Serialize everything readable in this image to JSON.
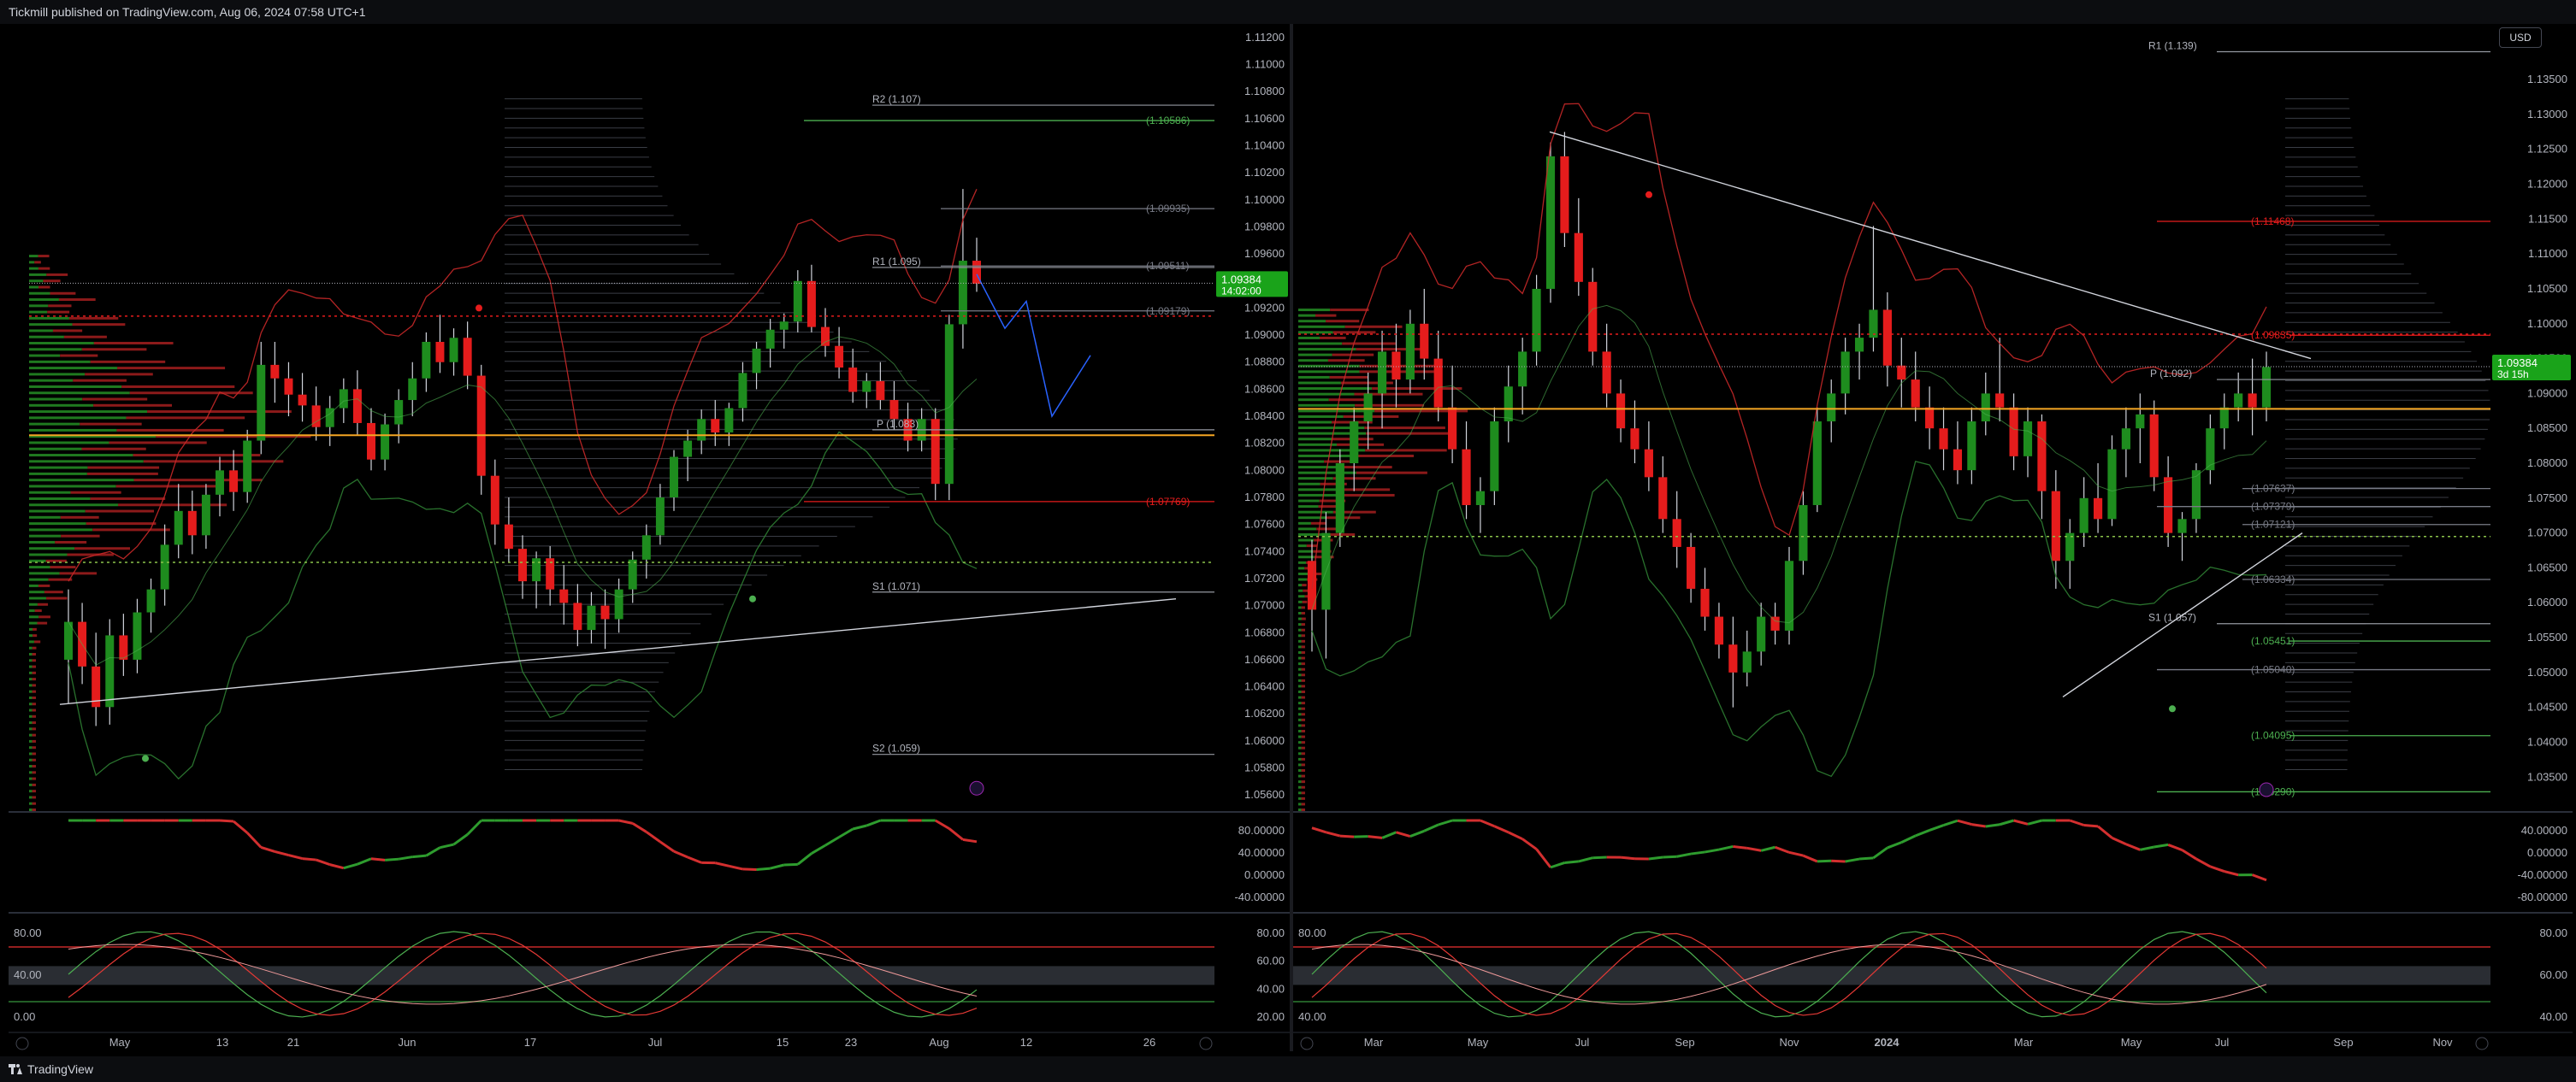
{
  "header": {
    "published": "Tickmill published on TradingView.com, Aug 06, 2024 07:58 UTC+1"
  },
  "footer": {
    "brand": "TradingView"
  },
  "colors": {
    "up": "#1e8c1e",
    "down": "#e51c1c",
    "poc": "#f5a623",
    "green_line": "#4caf50",
    "red_line": "#c62828",
    "pivot": "#9598a1",
    "label_bg_green": "#1a8a1a",
    "price_tag": "#1aa31a"
  },
  "left": {
    "price_tag": "1.09384",
    "countdown": "14:02:00",
    "price_axis": [
      "1.11200",
      "1.11000",
      "1.10800",
      "1.10600",
      "1.10400",
      "1.10200",
      "1.10000",
      "1.09800",
      "1.09600",
      "1.09400",
      "1.09200",
      "1.09000",
      "1.08800",
      "1.08600",
      "1.08400",
      "1.08200",
      "1.08000",
      "1.07800",
      "1.07600",
      "1.07400",
      "1.07200",
      "1.07000",
      "1.06800",
      "1.06600",
      "1.06400",
      "1.06200",
      "1.06000",
      "1.05800",
      "1.05600"
    ],
    "time_axis": [
      "May",
      "13",
      "21",
      "Jun",
      "17",
      "Jul",
      "15",
      "23",
      "Aug",
      "12",
      "26"
    ],
    "pivots": [
      {
        "label": "R2 (1.107)"
      },
      {
        "label": "R1 (1.095)"
      },
      {
        "label": "P (1.083)"
      },
      {
        "label": "S1 (1.071)"
      },
      {
        "label": "S2 (1.059)"
      }
    ],
    "levels": [
      {
        "label": "(1.10586)",
        "color": "#4caf50"
      },
      {
        "label": "(1.09935)",
        "color": "#787b86"
      },
      {
        "label": "(1.09511)",
        "color": "#787b86"
      },
      {
        "label": "(1.09179)",
        "color": "#787b86"
      },
      {
        "label": "(1.07769)",
        "color": "#e51c1c"
      }
    ],
    "osc1_axis": [
      "80.00000",
      "40.00000",
      "0.00000",
      "-40.00000"
    ],
    "osc2_axis_left": [
      "80.00",
      "40.00",
      "0.00"
    ],
    "osc2_axis_right": [
      "80.00",
      "60.00",
      "40.00",
      "20.00"
    ]
  },
  "right": {
    "price_tag": "1.09384",
    "countdown": "3d 15h",
    "currency": "USD",
    "price_axis": [
      "1.13500",
      "1.13000",
      "1.12500",
      "1.12000",
      "1.11500",
      "1.11000",
      "1.10500",
      "1.10000",
      "1.09500",
      "1.09000",
      "1.08500",
      "1.08000",
      "1.07500",
      "1.07000",
      "1.06500",
      "1.06000",
      "1.05500",
      "1.05000",
      "1.04500",
      "1.04000",
      "1.03500"
    ],
    "time_axis": [
      "Mar",
      "May",
      "Jul",
      "Sep",
      "Nov",
      "2024",
      "Mar",
      "May",
      "Jul",
      "Sep",
      "Nov"
    ],
    "pivots": [
      {
        "label": "R1 (1.139)"
      },
      {
        "label": "P (1.092)"
      },
      {
        "label": "S1 (1.057)"
      }
    ],
    "levels": [
      {
        "label": "(1.11468)",
        "color": "#e51c1c"
      },
      {
        "label": "(1.09835)",
        "color": "#e51c1c"
      },
      {
        "label": "(1.07637)",
        "color": "#787b86"
      },
      {
        "label": "(1.07379)",
        "color": "#787b86"
      },
      {
        "label": "(1.07121)",
        "color": "#787b86"
      },
      {
        "label": "(1.06334)",
        "color": "#787b86"
      },
      {
        "label": "(1.05451)",
        "color": "#4caf50"
      },
      {
        "label": "(1.05040)",
        "color": "#787b86"
      },
      {
        "label": "(1.04095)",
        "color": "#4caf50"
      },
      {
        "label": "(1.03290)",
        "color": "#4caf50"
      }
    ],
    "osc1_axis": [
      "40.00000",
      "0.00000",
      "-40.00000",
      "-80.00000"
    ],
    "osc2_axis_left": [
      "80.00",
      "40.00"
    ],
    "osc2_axis_right": [
      "80.00",
      "60.00",
      "40.00"
    ]
  },
  "chart_data": [
    {
      "type": "candlestick",
      "symbol_panel": "left",
      "x_range": [
        "Apr 22, 2024",
        "Sep 02, 2024"
      ],
      "ylim": [
        1.055,
        1.1125
      ],
      "last_price": 1.09384,
      "candles_ohlc": [
        [
          1.066,
          1.0712,
          1.0628,
          1.0688
        ],
        [
          1.0688,
          1.0702,
          1.0642,
          1.0655
        ],
        [
          1.0655,
          1.068,
          1.0611,
          1.0625
        ],
        [
          1.0625,
          1.069,
          1.0612,
          1.0678
        ],
        [
          1.0678,
          1.0694,
          1.0648,
          1.066
        ],
        [
          1.066,
          1.0705,
          1.065,
          1.0695
        ],
        [
          1.0695,
          1.072,
          1.068,
          1.0712
        ],
        [
          1.0712,
          1.076,
          1.07,
          1.0745
        ],
        [
          1.0745,
          1.079,
          1.0735,
          1.077
        ],
        [
          1.077,
          1.0785,
          1.0738,
          1.0752
        ],
        [
          1.0752,
          1.079,
          1.0742,
          1.0782
        ],
        [
          1.0782,
          1.081,
          1.0766,
          1.08
        ],
        [
          1.08,
          1.0815,
          1.077,
          1.0784
        ],
        [
          1.0784,
          1.083,
          1.0776,
          1.0822
        ],
        [
          1.0822,
          1.0895,
          1.0812,
          1.0878
        ],
        [
          1.0878,
          1.0895,
          1.085,
          1.0868
        ],
        [
          1.0868,
          1.088,
          1.084,
          1.0856
        ],
        [
          1.0856,
          1.0872,
          1.0836,
          1.0848
        ],
        [
          1.0848,
          1.0862,
          1.0822,
          1.0832
        ],
        [
          1.0832,
          1.0855,
          1.0818,
          1.0846
        ],
        [
          1.0846,
          1.0868,
          1.0835,
          1.086
        ],
        [
          1.086,
          1.0874,
          1.0826,
          1.0835
        ],
        [
          1.0835,
          1.0846,
          1.08,
          1.0808
        ],
        [
          1.0808,
          1.0842,
          1.08,
          1.0834
        ],
        [
          1.0834,
          1.086,
          1.082,
          1.0852
        ],
        [
          1.0852,
          1.088,
          1.084,
          1.0868
        ],
        [
          1.0868,
          1.0902,
          1.0858,
          1.0895
        ],
        [
          1.0895,
          1.0915,
          1.0872,
          1.088
        ],
        [
          1.088,
          1.0905,
          1.087,
          1.0898
        ],
        [
          1.0898,
          1.091,
          1.086,
          1.087
        ],
        [
          1.087,
          1.0878,
          1.0782,
          1.0796
        ],
        [
          1.0796,
          1.0808,
          1.0745,
          1.076
        ],
        [
          1.076,
          1.078,
          1.0732,
          1.0742
        ],
        [
          1.0742,
          1.0752,
          1.0705,
          1.0718
        ],
        [
          1.0718,
          1.074,
          1.0698,
          1.0735
        ],
        [
          1.0735,
          1.0744,
          1.07,
          1.0712
        ],
        [
          1.0712,
          1.073,
          1.0686,
          1.0702
        ],
        [
          1.0702,
          1.0716,
          1.067,
          1.0682
        ],
        [
          1.0682,
          1.071,
          1.0672,
          1.07
        ],
        [
          1.07,
          1.0712,
          1.0668,
          1.069
        ],
        [
          1.069,
          1.072,
          1.068,
          1.0712
        ],
        [
          1.0712,
          1.074,
          1.0702,
          1.0734
        ],
        [
          1.0734,
          1.076,
          1.072,
          1.0752
        ],
        [
          1.0752,
          1.079,
          1.0745,
          1.078
        ],
        [
          1.078,
          1.0815,
          1.077,
          1.081
        ],
        [
          1.081,
          1.083,
          1.0792,
          1.0822
        ],
        [
          1.0822,
          1.0845,
          1.0812,
          1.0838
        ],
        [
          1.0838,
          1.0852,
          1.0818,
          1.0828
        ],
        [
          1.0828,
          1.085,
          1.0818,
          1.0846
        ],
        [
          1.0846,
          1.088,
          1.0836,
          1.0872
        ],
        [
          1.0872,
          1.0895,
          1.086,
          1.089
        ],
        [
          1.089,
          1.0912,
          1.0876,
          1.0904
        ],
        [
          1.0904,
          1.0916,
          1.089,
          1.091
        ],
        [
          1.091,
          1.0948,
          1.0902,
          1.094
        ],
        [
          1.094,
          1.0952,
          1.0902,
          1.0906
        ],
        [
          1.0906,
          1.092,
          1.0884,
          1.0892
        ],
        [
          1.0892,
          1.0906,
          1.0868,
          1.0876
        ],
        [
          1.0876,
          1.089,
          1.085,
          1.0858
        ],
        [
          1.0858,
          1.0872,
          1.0846,
          1.0866
        ],
        [
          1.0866,
          1.088,
          1.0845,
          1.0852
        ],
        [
          1.0852,
          1.0866,
          1.083,
          1.0838
        ],
        [
          1.0838,
          1.085,
          1.0814,
          1.0822
        ],
        [
          1.0822,
          1.0846,
          1.0814,
          1.0838
        ],
        [
          1.0838,
          1.0846,
          1.0778,
          1.079
        ],
        [
          1.079,
          1.0915,
          1.0778,
          1.0908
        ],
        [
          1.0908,
          1.1008,
          1.089,
          1.0955
        ],
        [
          1.0955,
          1.0972,
          1.0932,
          1.0938
        ]
      ],
      "overlays": [
        "bollinger bands",
        "volume profile",
        "pivot points",
        "trendline",
        "projection path"
      ]
    },
    {
      "type": "candlestick",
      "symbol_panel": "right",
      "x_range": [
        "Feb 2023",
        "Nov 2024"
      ],
      "ylim": [
        1.0305,
        1.142
      ],
      "last_price": 1.09384,
      "candles_ohlc": [
        [
          1.066,
          1.069,
          1.053,
          1.059
        ],
        [
          1.059,
          1.073,
          1.052,
          1.07
        ],
        [
          1.07,
          1.082,
          1.068,
          1.08
        ],
        [
          1.08,
          1.088,
          1.076,
          1.086
        ],
        [
          1.086,
          1.093,
          1.082,
          1.09
        ],
        [
          1.09,
          1.099,
          1.085,
          1.096
        ],
        [
          1.096,
          1.1,
          1.088,
          1.092
        ],
        [
          1.092,
          1.102,
          1.09,
          1.1
        ],
        [
          1.1,
          1.105,
          1.092,
          1.095
        ],
        [
          1.095,
          1.099,
          1.086,
          1.088
        ],
        [
          1.088,
          1.094,
          1.08,
          1.082
        ],
        [
          1.082,
          1.086,
          1.072,
          1.074
        ],
        [
          1.074,
          1.078,
          1.07,
          1.076
        ],
        [
          1.076,
          1.088,
          1.074,
          1.086
        ],
        [
          1.086,
          1.094,
          1.083,
          1.091
        ],
        [
          1.091,
          1.098,
          1.087,
          1.096
        ],
        [
          1.096,
          1.107,
          1.094,
          1.105
        ],
        [
          1.105,
          1.126,
          1.103,
          1.124
        ],
        [
          1.124,
          1.1275,
          1.111,
          1.113
        ],
        [
          1.113,
          1.118,
          1.104,
          1.106
        ],
        [
          1.106,
          1.108,
          1.094,
          1.096
        ],
        [
          1.096,
          1.1,
          1.088,
          1.09
        ],
        [
          1.09,
          1.092,
          1.083,
          1.085
        ],
        [
          1.085,
          1.089,
          1.08,
          1.082
        ],
        [
          1.082,
          1.086,
          1.076,
          1.078
        ],
        [
          1.078,
          1.081,
          1.07,
          1.072
        ],
        [
          1.072,
          1.076,
          1.065,
          1.068
        ],
        [
          1.068,
          1.07,
          1.06,
          1.062
        ],
        [
          1.062,
          1.065,
          1.056,
          1.058
        ],
        [
          1.058,
          1.06,
          1.052,
          1.054
        ],
        [
          1.054,
          1.058,
          1.045,
          1.05
        ],
        [
          1.05,
          1.056,
          1.048,
          1.053
        ],
        [
          1.053,
          1.06,
          1.051,
          1.058
        ],
        [
          1.058,
          1.06,
          1.054,
          1.056
        ],
        [
          1.056,
          1.068,
          1.054,
          1.066
        ],
        [
          1.066,
          1.076,
          1.064,
          1.074
        ],
        [
          1.074,
          1.088,
          1.073,
          1.086
        ],
        [
          1.086,
          1.092,
          1.083,
          1.09
        ],
        [
          1.09,
          1.098,
          1.087,
          1.096
        ],
        [
          1.096,
          1.1,
          1.092,
          1.098
        ],
        [
          1.098,
          1.114,
          1.096,
          1.102
        ],
        [
          1.102,
          1.1045,
          1.091,
          1.094
        ],
        [
          1.094,
          1.098,
          1.088,
          1.092
        ],
        [
          1.092,
          1.096,
          1.086,
          1.088
        ],
        [
          1.088,
          1.091,
          1.082,
          1.085
        ],
        [
          1.085,
          1.088,
          1.079,
          1.082
        ],
        [
          1.082,
          1.086,
          1.077,
          1.079
        ],
        [
          1.079,
          1.088,
          1.077,
          1.086
        ],
        [
          1.086,
          1.093,
          1.084,
          1.09
        ],
        [
          1.09,
          1.098,
          1.086,
          1.088
        ],
        [
          1.088,
          1.09,
          1.079,
          1.081
        ],
        [
          1.081,
          1.088,
          1.078,
          1.086
        ],
        [
          1.086,
          1.087,
          1.072,
          1.076
        ],
        [
          1.076,
          1.079,
          1.062,
          1.066
        ],
        [
          1.066,
          1.072,
          1.062,
          1.07
        ],
        [
          1.07,
          1.078,
          1.068,
          1.075
        ],
        [
          1.075,
          1.08,
          1.07,
          1.072
        ],
        [
          1.072,
          1.084,
          1.071,
          1.082
        ],
        [
          1.082,
          1.088,
          1.078,
          1.085
        ],
        [
          1.085,
          1.09,
          1.08,
          1.087
        ],
        [
          1.087,
          1.089,
          1.076,
          1.078
        ],
        [
          1.078,
          1.081,
          1.068,
          1.07
        ],
        [
          1.07,
          1.073,
          1.066,
          1.072
        ],
        [
          1.072,
          1.08,
          1.07,
          1.079
        ],
        [
          1.079,
          1.087,
          1.077,
          1.085
        ],
        [
          1.085,
          1.09,
          1.082,
          1.088
        ],
        [
          1.088,
          1.093,
          1.086,
          1.09
        ],
        [
          1.09,
          1.095,
          1.084,
          1.088
        ],
        [
          1.088,
          1.096,
          1.086,
          1.0938
        ]
      ],
      "overlays": [
        "bollinger bands",
        "volume profile",
        "pivot points",
        "trendlines"
      ]
    }
  ]
}
